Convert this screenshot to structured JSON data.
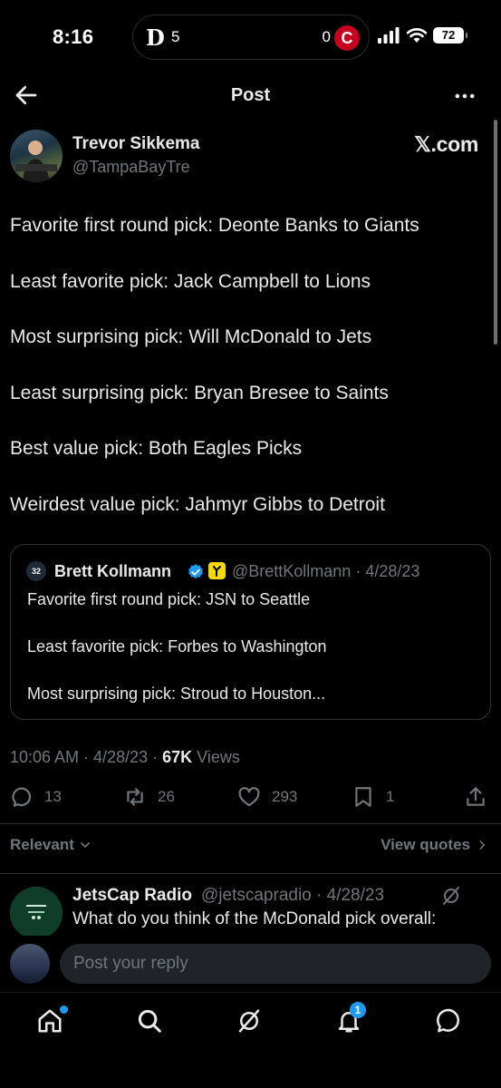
{
  "status_bar": {
    "time": "8:16",
    "live_activity": {
      "team_left_logo": "D",
      "score_left": "5",
      "score_right": "0",
      "team_right_logo": "C"
    },
    "battery": "72"
  },
  "header": {
    "title": "Post",
    "back_icon": "arrow-left-icon",
    "more_icon": "more-horizontal-icon"
  },
  "post": {
    "author_name": "Trevor Sikkema",
    "author_handle": "@TampaBayTre",
    "source_badge": "𝕏.com",
    "lines": [
      "Favorite first round pick: Deonte Banks to Giants",
      "Least favorite pick: Jack Campbell to Lions",
      "Most surprising pick: Will McDonald to Jets",
      "Least surprising pick: Bryan Bresee to Saints",
      "Best value pick: Both Eagles Picks",
      "Weirdest value pick: Jahmyr Gibbs to Detroit"
    ],
    "quote": {
      "avatar_text": "32",
      "name": "Brett Kollmann",
      "meta": "@BrettKollmann · 4/28/23",
      "lines": [
        "Favorite first round pick: JSN to Seattle",
        "Least favorite pick: Forbes to Washington",
        "Most surprising pick: Stroud to Houston..."
      ]
    },
    "time_date": "10:06 AM · 4/28/23 · ",
    "views_count": "67K",
    "views_label": " Views",
    "stats": {
      "replies": "13",
      "reposts": "26",
      "likes": "293",
      "bookmarks": "1"
    }
  },
  "replies_section": {
    "sort_label": "Relevant",
    "view_quotes_label": "View quotes",
    "reply": {
      "name": "JetsCap Radio",
      "meta": "@jetscapradio · 4/28/23",
      "text": "What do you think of the McDonald pick overall:"
    }
  },
  "composer": {
    "placeholder": "Post your reply"
  },
  "bottom_nav": {
    "items": [
      "home-icon",
      "search-icon",
      "grok-icon",
      "notifications-icon",
      "messages-icon"
    ],
    "notification_badge": "1"
  },
  "colors": {
    "background": "#000000",
    "text": "#e7e9ea",
    "muted": "#71767b",
    "accent": "#1d9bf0",
    "border": "#2f3336"
  }
}
